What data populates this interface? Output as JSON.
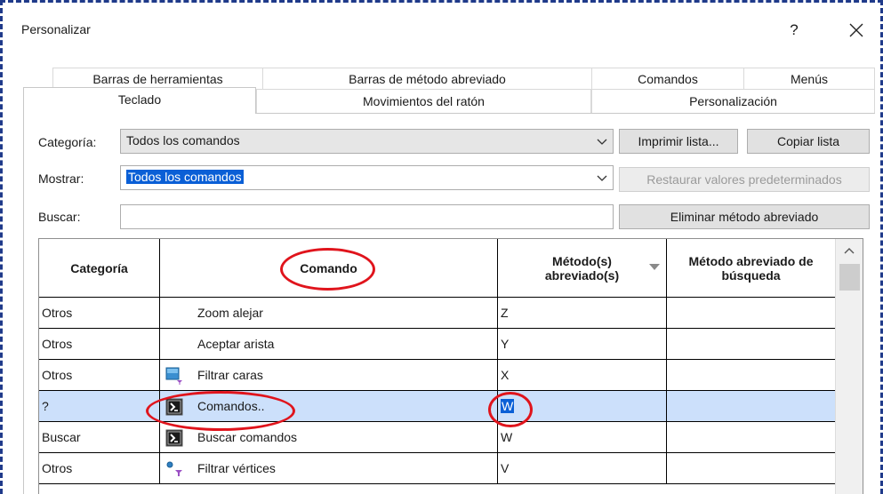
{
  "window": {
    "title": "Personalizar",
    "help_label": "?"
  },
  "tabs": {
    "row1": [
      "Barras de herramientas",
      "Barras de método abreviado",
      "Comandos",
      "Menús"
    ],
    "row2": [
      "Teclado",
      "Movimientos del ratón",
      "Personalización"
    ],
    "active": "Teclado"
  },
  "filters": {
    "category_label": "Categoría:",
    "category_value": "Todos los comandos",
    "show_label": "Mostrar:",
    "show_value": "Todos los comandos",
    "search_label": "Buscar:",
    "search_value": ""
  },
  "buttons": {
    "print_list": "Imprimir lista...",
    "copy_list": "Copiar lista",
    "restore_defaults": "Restaurar valores predeterminados",
    "remove_shortcut": "Eliminar método abreviado"
  },
  "table": {
    "headers": [
      "Categoría",
      "Comando",
      "Método(s) abreviado(s)",
      "Método abreviado de búsqueda"
    ],
    "rows": [
      {
        "category": "Otros",
        "command": "Zoom alejar",
        "shortcut": "Z",
        "search": "",
        "icon": "none"
      },
      {
        "category": "Otros",
        "command": "Aceptar arista",
        "shortcut": "Y",
        "search": "",
        "icon": "none"
      },
      {
        "category": "Otros",
        "command": "Filtrar caras",
        "shortcut": "X",
        "search": "",
        "icon": "filter-faces-icon"
      },
      {
        "category": "?",
        "command": "Comandos..",
        "shortcut": "W",
        "search": "",
        "icon": "command-prompt-icon",
        "selected": true
      },
      {
        "category": "Buscar",
        "command": "Buscar comandos",
        "shortcut": "W",
        "search": "",
        "icon": "command-prompt-icon"
      },
      {
        "category": "Otros",
        "command": "Filtrar vértices",
        "shortcut": "V",
        "search": "",
        "icon": "filter-vertices-icon"
      }
    ]
  },
  "colors": {
    "accent": "#0a5fd6",
    "selected_row": "#cce0fb",
    "highlight_oval": "#e0141c",
    "frame": "#1f3a8a"
  }
}
